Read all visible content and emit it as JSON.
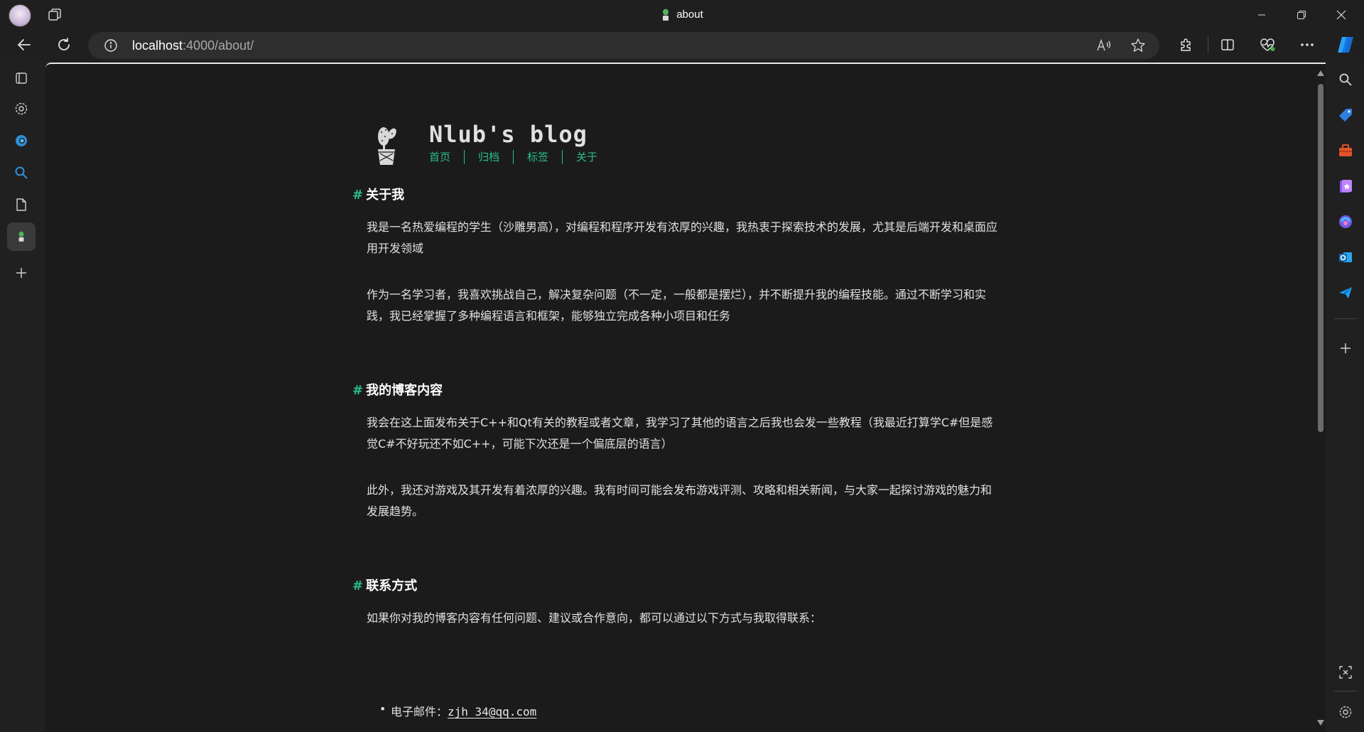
{
  "browser": {
    "tab_title": "about",
    "address": {
      "host": "localhost",
      "path": ":4000/about/"
    }
  },
  "icons": {
    "titlebar": [
      "profile-avatar",
      "collections-icon",
      "minimize-icon",
      "restore-icon",
      "close-icon"
    ],
    "toolbar": [
      "back-icon",
      "refresh-icon",
      "site-info-icon",
      "read-aloud-icon",
      "favorite-star-icon",
      "extensions-icon",
      "split-screen-icon",
      "browser-essentials-icon",
      "more-icon",
      "copilot-icon"
    ],
    "leftbar": [
      "tab-actions-icon",
      "settings-tab-icon",
      "edge-tab-icon",
      "search-tab-icon",
      "document-tab-icon",
      "blog-tab-icon",
      "new-tab-plus-icon"
    ],
    "rightbar": [
      "search-icon",
      "tag-icon",
      "tools-icon",
      "games-icon",
      "copilot-app-icon",
      "outlook-icon",
      "send-icon",
      "add-icon",
      "screenshot-icon",
      "settings-icon"
    ]
  },
  "blog": {
    "title": "Nlub's blog",
    "nav": [
      "首页",
      "归档",
      "标签",
      "关于"
    ]
  },
  "article": {
    "sections": [
      {
        "heading": "关于我",
        "paragraphs": [
          "我是一名热爱编程的学生（沙雕男高），对编程和程序开发有浓厚的兴趣，我热衷于探索技术的发展，尤其是后端开发和桌面应用开发领域",
          "作为一名学习者，我喜欢挑战自己，解决复杂问题（不一定，一般都是摆烂），并不断提升我的编程技能。通过不断学习和实践，我已经掌握了多种编程语言和框架，能够独立完成各种小项目和任务"
        ]
      },
      {
        "heading": "我的博客内容",
        "paragraphs": [
          "我会在这上面发布关于C++和Qt有关的教程或者文章，我学习了其他的语言之后我也会发一些教程（我最近打算学C#但是感觉C#不好玩还不如C++，可能下次还是一个偏底层的语言）",
          "此外，我还对游戏及其开发有着浓厚的兴趣。我有时间可能会发布游戏评测、攻略和相关新闻，与大家一起探讨游戏的魅力和发展趋势。"
        ]
      },
      {
        "heading": "联系方式",
        "paragraphs": [
          "如果你对我的博客内容有任何问题、建议或合作意向，都可以通过以下方式与我取得联系："
        ],
        "contact": {
          "label": "电子邮件：",
          "email": "zjh_34@qq.com"
        }
      }
    ]
  },
  "colors": {
    "accent": "#2bbc8a",
    "page_bg": "#1b1b1b",
    "chrome_bg": "#1f1f1f"
  }
}
